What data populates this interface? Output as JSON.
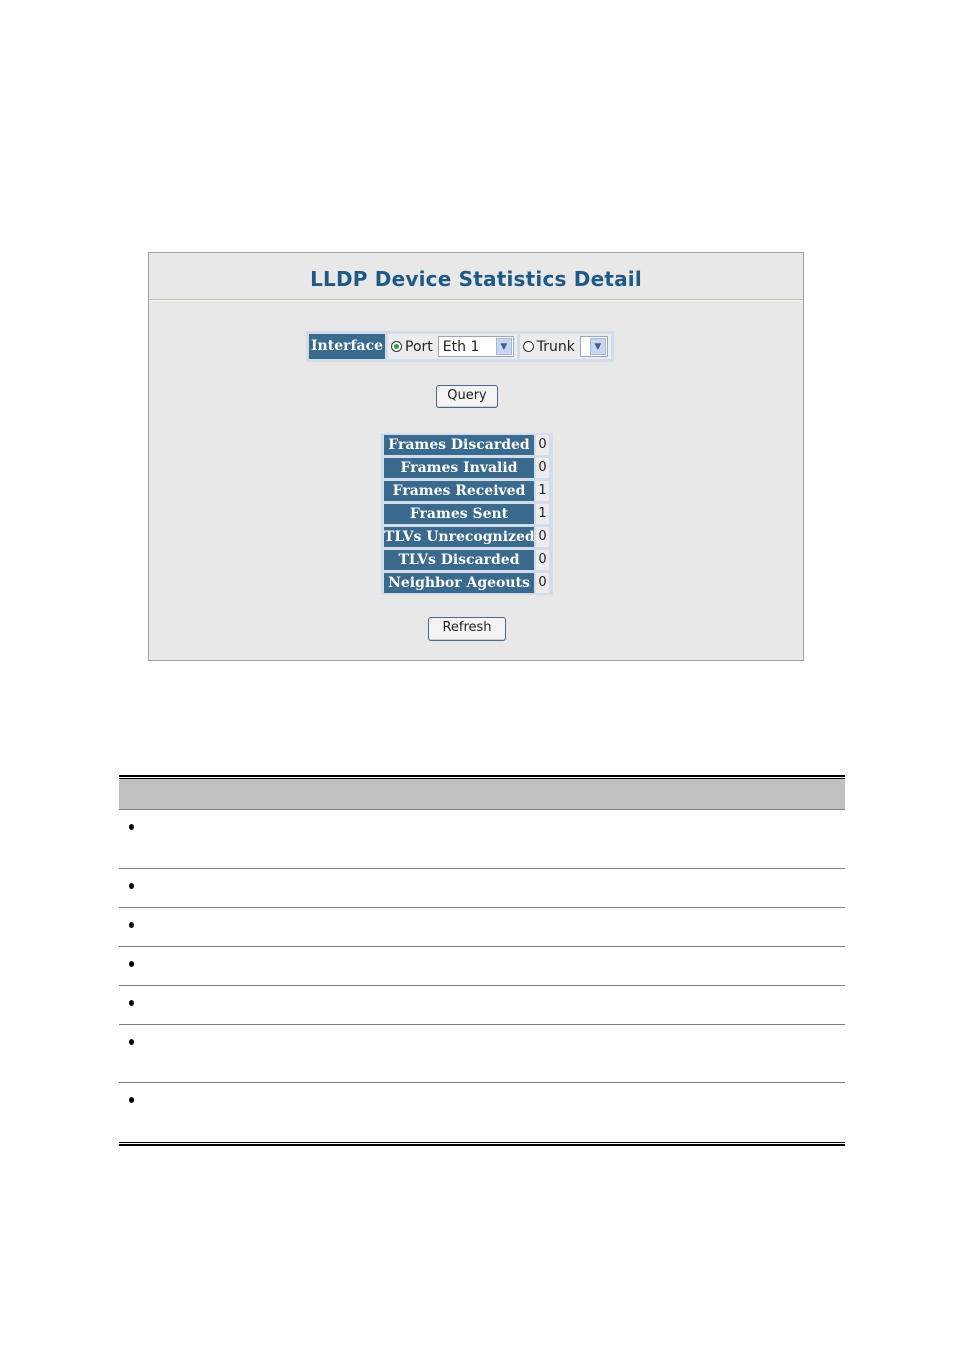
{
  "panel": {
    "title": "LLDP Device Statistics Detail",
    "interface_label": "Interface",
    "port_radio": {
      "label": "Port",
      "selected": true
    },
    "port_select": {
      "value": "Eth 1"
    },
    "trunk_radio": {
      "label": "Trunk",
      "selected": false
    },
    "trunk_select": {
      "value": ""
    },
    "query_label": "Query",
    "refresh_label": "Refresh"
  },
  "stats": [
    {
      "label": "Frames Discarded",
      "value": "0"
    },
    {
      "label": "Frames Invalid",
      "value": "0"
    },
    {
      "label": "Frames Received",
      "value": "1"
    },
    {
      "label": "Frames Sent",
      "value": "1"
    },
    {
      "label": "TLVs Unrecognized",
      "value": "0"
    },
    {
      "label": "TLVs Discarded",
      "value": "0"
    },
    {
      "label": "Neighbor Ageouts",
      "value": "0"
    }
  ],
  "doc_table": {
    "header": "",
    "rows": [
      "",
      "",
      "",
      "",
      "",
      "",
      ""
    ]
  }
}
